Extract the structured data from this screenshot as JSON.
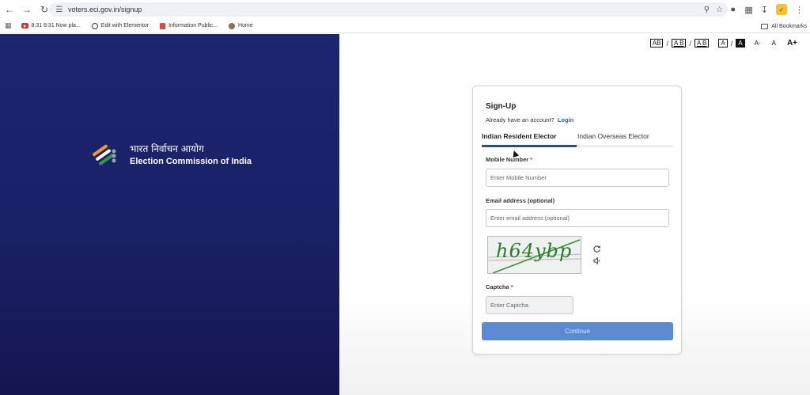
{
  "browser": {
    "url": "voters.eci.gov.in/signup",
    "bookmarks": [
      {
        "label": "8:31 8:31 Now pla..."
      },
      {
        "label": "Edit with Elementor"
      },
      {
        "label": "Information Public..."
      },
      {
        "label": "Home"
      }
    ],
    "all_bookmarks": "All Bookmarks"
  },
  "brand": {
    "hindi": "भारत निर्वाचन आयोग",
    "english": "Election Commission of India"
  },
  "accessibility": {
    "items": [
      "AB",
      "A B",
      "A  B",
      "A",
      "A",
      "A-",
      "A",
      "A+"
    ]
  },
  "signup": {
    "title": "Sign-Up",
    "have_account": "Already have an account?",
    "login_link": "Login",
    "tabs": [
      {
        "label": "Indian Resident Elector",
        "active": true
      },
      {
        "label": "Indian Overseas Elector",
        "active": false
      }
    ],
    "mobile": {
      "label": "Mobile Number",
      "required": "*",
      "placeholder": "Enter Mobile Number"
    },
    "email": {
      "label": "Email address (optional)",
      "placeholder": "Enter email address (optional)"
    },
    "captcha_text": "h64ybp",
    "captcha": {
      "label": "Captcha",
      "required": "*",
      "placeholder": "Enter Captcha"
    },
    "continue_label": "Continue"
  },
  "colors": {
    "left_panel": "#1c2570",
    "tab_underline": "#2c4a8e",
    "continue_button": "#5b8ad2",
    "required": "#d32f2f",
    "captcha_text": "#2e7b2e"
  }
}
